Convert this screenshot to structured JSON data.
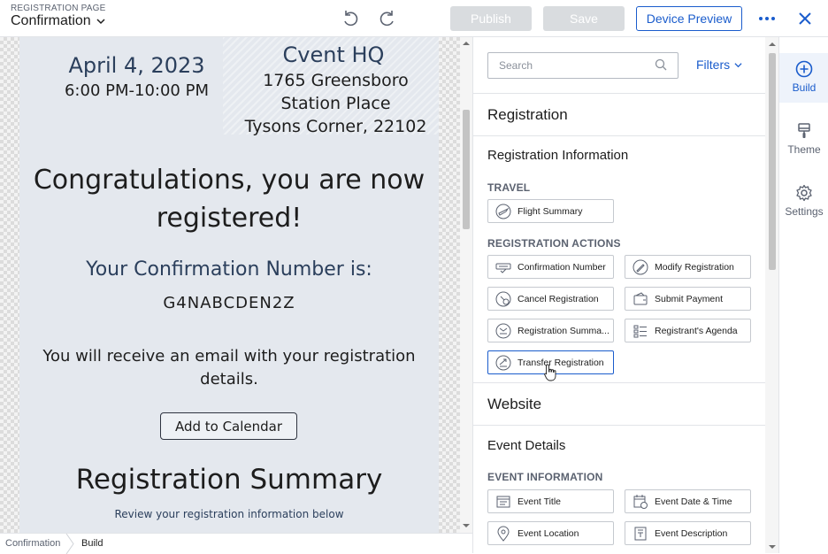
{
  "header": {
    "page_label": "REGISTRATION PAGE",
    "page_name": "Confirmation",
    "publish_label": "Publish",
    "save_label": "Save",
    "preview_label": "Device Preview"
  },
  "canvas": {
    "event_date": "April 4, 2023",
    "event_time": "6:00 PM-10:00 PM",
    "venue_name": "Cvent HQ",
    "venue_address_1": "1765 Greensboro",
    "venue_address_2": "Station Place",
    "venue_address_3": "Tysons Corner, 22102",
    "congrats_line_1": "Congratulations, you are now",
    "congrats_line_2": "registered!",
    "confirmation_label": "Your Confirmation Number is:",
    "confirmation_number": "G4NABCDEN2Z",
    "email_line_1": "You will receive an email with your registration",
    "email_line_2": "details.",
    "add_calendar_label": "Add to Calendar",
    "summary_title": "Registration Summary",
    "summary_subtitle": "Review your registration information below"
  },
  "breadcrumb": {
    "items": [
      "Confirmation",
      "Build"
    ]
  },
  "panel": {
    "search_placeholder": "Search",
    "filters_label": "Filters",
    "sections": [
      {
        "title": "Registration",
        "subsection": "Registration Information",
        "categories": [
          {
            "label": "TRAVEL",
            "items": [
              "Flight Summary"
            ]
          },
          {
            "label": "REGISTRATION ACTIONS",
            "items": [
              "Confirmation Number",
              "Modify Registration",
              "Cancel Registration",
              "Submit Payment",
              "Registration Summa...",
              "Registrant's Agenda",
              "Transfer Registration"
            ]
          }
        ]
      },
      {
        "title": "Website",
        "subsection": "Event Details",
        "categories": [
          {
            "label": "EVENT INFORMATION",
            "items": [
              "Event Title",
              "Event Date & Time",
              "Event Location",
              "Event Description"
            ]
          }
        ]
      }
    ]
  },
  "rail": {
    "items": [
      {
        "label": "Build",
        "icon": "plus-circle-icon",
        "active": true
      },
      {
        "label": "Theme",
        "icon": "brush-icon",
        "active": false
      },
      {
        "label": "Settings",
        "icon": "gear-icon",
        "active": false
      }
    ]
  },
  "colors": {
    "accent": "#1a5ccc",
    "page_background": "#e4e8ee",
    "disabled_button": "#d9dcdf"
  }
}
